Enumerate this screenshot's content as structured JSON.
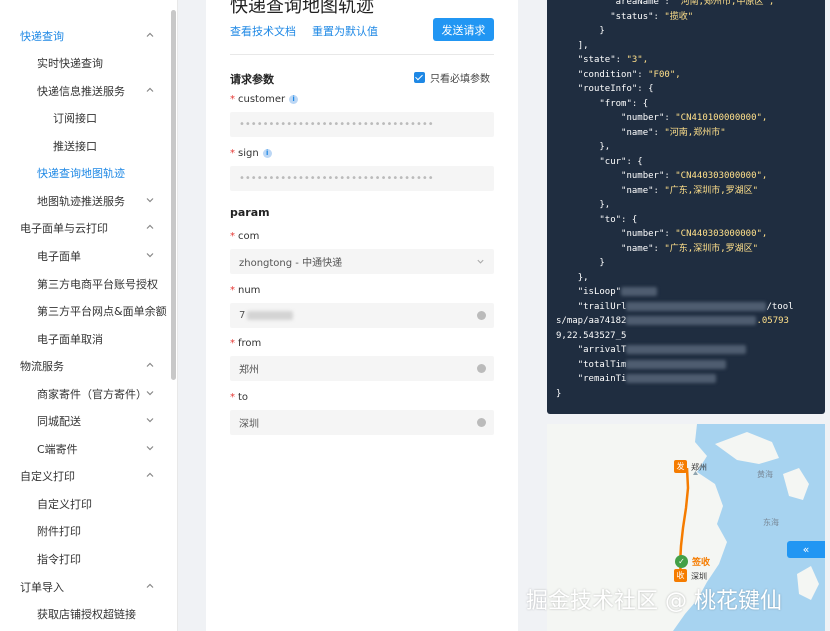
{
  "sidebar": {
    "items": [
      {
        "label": "快递查询",
        "level": 1,
        "state": "active",
        "chevron": "up"
      },
      {
        "label": "实时快递查询",
        "level": 2,
        "state": "",
        "chevron": ""
      },
      {
        "label": "快递信息推送服务",
        "level": 2,
        "state": "",
        "chevron": "up"
      },
      {
        "label": "订阅接口",
        "level": 3,
        "state": "",
        "chevron": ""
      },
      {
        "label": "推送接口",
        "level": 3,
        "state": "",
        "chevron": ""
      },
      {
        "label": "快递查询地图轨迹",
        "level": 2,
        "state": "selected",
        "chevron": ""
      },
      {
        "label": "地图轨迹推送服务",
        "level": 2,
        "state": "",
        "chevron": "down"
      },
      {
        "label": "电子面单与云打印",
        "level": 1,
        "state": "",
        "chevron": "up"
      },
      {
        "label": "电子面单",
        "level": 2,
        "state": "",
        "chevron": "down"
      },
      {
        "label": "第三方电商平台账号授权",
        "level": 2,
        "state": "",
        "chevron": ""
      },
      {
        "label": "第三方平台网点&面单余额",
        "level": 2,
        "state": "",
        "chevron": ""
      },
      {
        "label": "电子面单取消",
        "level": 2,
        "state": "",
        "chevron": ""
      },
      {
        "label": "物流服务",
        "level": 1,
        "state": "",
        "chevron": "up"
      },
      {
        "label": "商家寄件（官方寄件）",
        "level": 2,
        "state": "",
        "chevron": "down"
      },
      {
        "label": "同城配送",
        "level": 2,
        "state": "",
        "chevron": "down"
      },
      {
        "label": "C端寄件",
        "level": 2,
        "state": "",
        "chevron": "down"
      },
      {
        "label": "自定义打印",
        "level": 1,
        "state": "",
        "chevron": "up"
      },
      {
        "label": "自定义打印",
        "level": 2,
        "state": "",
        "chevron": ""
      },
      {
        "label": "附件打印",
        "level": 2,
        "state": "",
        "chevron": ""
      },
      {
        "label": "指令打印",
        "level": 2,
        "state": "",
        "chevron": ""
      },
      {
        "label": "订单导入",
        "level": 1,
        "state": "",
        "chevron": "up"
      },
      {
        "label": "获取店铺授权超链接",
        "level": 2,
        "state": "",
        "chevron": ""
      }
    ]
  },
  "form": {
    "title": "快递查询地图轨迹",
    "link_docs": "查看技术文档",
    "link_reset": "重置为默认值",
    "send_button": "发送请求",
    "request_params_heading": "请求参数",
    "only_required_label": "只看必填参数",
    "only_required_checked": true,
    "param_heading": "param",
    "fields": {
      "customer": {
        "label": "customer",
        "value": "•••••••••••••••••••••••••••••••••"
      },
      "sign": {
        "label": "sign",
        "value": "•••••••••••••••••••••••••••••••••"
      },
      "com": {
        "label": "com",
        "value": "zhongtong - 中通快递"
      },
      "num": {
        "label": "num",
        "value": "7"
      },
      "from": {
        "label": "from",
        "value": "郑州"
      },
      "to": {
        "label": "to",
        "value": "深圳"
      }
    }
  },
  "code": {
    "lines": [
      {
        "indent": "          ",
        "key": "\"areaName\"",
        "value": "\"河南,郑州市,中原区\","
      },
      {
        "indent": "          ",
        "key": "\"status\"",
        "value": "\"揽收\""
      },
      {
        "indent": "        ",
        "raw": "}"
      },
      {
        "indent": "    ",
        "raw": "],"
      },
      {
        "indent": "    ",
        "key": "\"state\"",
        "value": "\"3\","
      },
      {
        "indent": "    ",
        "key": "\"condition\"",
        "value": "\"F00\","
      },
      {
        "indent": "    ",
        "key": "\"routeInfo\"",
        "value": "{"
      },
      {
        "indent": "        ",
        "key": "\"from\"",
        "value": "{"
      },
      {
        "indent": "            ",
        "key": "\"number\"",
        "value": "\"CN410100000000\","
      },
      {
        "indent": "            ",
        "key": "\"name\"",
        "value": "\"河南,郑州市\""
      },
      {
        "indent": "        ",
        "raw": "},"
      },
      {
        "indent": "        ",
        "key": "\"cur\"",
        "value": "{"
      },
      {
        "indent": "            ",
        "key": "\"number\"",
        "value": "\"CN440303000000\","
      },
      {
        "indent": "            ",
        "key": "\"name\"",
        "value": "\"广东,深圳市,罗湖区\""
      },
      {
        "indent": "        ",
        "raw": "},"
      },
      {
        "indent": "        ",
        "key": "\"to\"",
        "value": "{"
      },
      {
        "indent": "            ",
        "key": "\"number\"",
        "value": "\"CN440303000000\","
      },
      {
        "indent": "            ",
        "key": "\"name\"",
        "value": "\"广东,深圳市,罗湖区\""
      },
      {
        "indent": "        ",
        "raw": "}"
      },
      {
        "indent": "    ",
        "raw": "},"
      },
      {
        "indent": "    ",
        "key": "\"isLoop\"",
        "value": ""
      },
      {
        "indent": "    ",
        "key": "\"trailUrl",
        "value": "/tool"
      },
      {
        "indent": "",
        "raw": "s/map/aa74182",
        "tail": ".05793"
      },
      {
        "indent": "",
        "raw": "9,22.543527_5",
        "tail": ""
      },
      {
        "indent": "    ",
        "key": "\"arrivalT",
        "value": ""
      },
      {
        "indent": "    ",
        "key": "\"totalTim",
        "value": ""
      },
      {
        "indent": "    ",
        "key": "\"remainTi",
        "value": ""
      },
      {
        "indent": "",
        "raw": "}"
      }
    ]
  },
  "map": {
    "from_badge": "发",
    "from_city": "郑州",
    "to_badge": "收",
    "to_city": "深圳",
    "status": "签收",
    "sea_label_1": "黄海",
    "sea_label_2": "东海",
    "toggle_label": "«"
  },
  "watermark": "掘金技术社区 @ 桃花键仙",
  "colors": {
    "accent": "#2196f3",
    "code_bg": "#1f2d40",
    "code_string": "#ffe08a",
    "route_orange": "#f57c00",
    "status_green": "#43a047",
    "map_sea": "#a7d3f0"
  }
}
